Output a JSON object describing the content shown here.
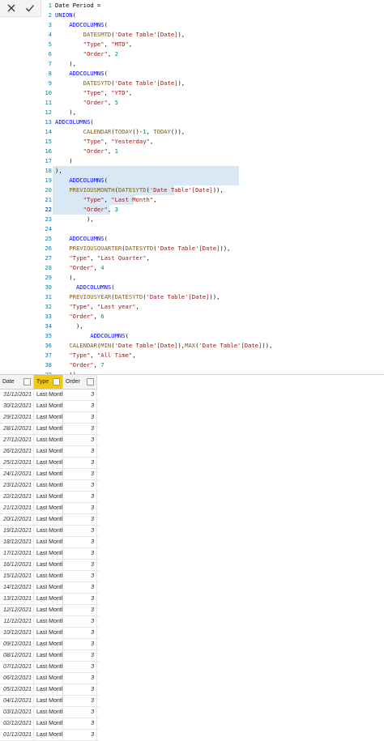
{
  "toolbar": {
    "cancel_icon": "close-icon",
    "commit_icon": "check-icon"
  },
  "editor": {
    "active_line": 22,
    "lines": [
      [
        [
          "p",
          "Date Period ="
        ]
      ],
      [
        [
          "k",
          "UNION"
        ],
        [
          "p",
          "("
        ]
      ],
      [
        [
          "p",
          "    "
        ],
        [
          "k",
          "ADDCOLUMNS"
        ],
        [
          "p",
          "("
        ]
      ],
      [
        [
          "p",
          "        "
        ],
        [
          "f",
          "DATESMTD"
        ],
        [
          "p",
          "("
        ],
        [
          "s",
          "'Date Table'[Date]"
        ],
        [
          "p",
          "),"
        ]
      ],
      [
        [
          "p",
          "        "
        ],
        [
          "s",
          "\"Type\""
        ],
        [
          "p",
          ", "
        ],
        [
          "s",
          "\"MTD\""
        ],
        [
          "p",
          ","
        ]
      ],
      [
        [
          "p",
          "        "
        ],
        [
          "s",
          "\"Order\""
        ],
        [
          "p",
          ", "
        ],
        [
          "n",
          "2"
        ]
      ],
      [
        [
          "p",
          "    ),"
        ]
      ],
      [
        [
          "p",
          "    "
        ],
        [
          "k",
          "ADDCOLUMNS"
        ],
        [
          "p",
          "("
        ]
      ],
      [
        [
          "p",
          "        "
        ],
        [
          "f",
          "DATESYTD"
        ],
        [
          "p",
          "("
        ],
        [
          "s",
          "'Date Table'[Date]"
        ],
        [
          "p",
          "),"
        ]
      ],
      [
        [
          "p",
          "        "
        ],
        [
          "s",
          "\"Type\""
        ],
        [
          "p",
          ", "
        ],
        [
          "s",
          "\"YTD\""
        ],
        [
          "p",
          ","
        ]
      ],
      [
        [
          "p",
          "        "
        ],
        [
          "s",
          "\"Order\""
        ],
        [
          "p",
          ", "
        ],
        [
          "n",
          "5"
        ]
      ],
      [
        [
          "p",
          "    ),"
        ]
      ],
      [
        [
          "k",
          "ADDCOLUMNS"
        ],
        [
          "p",
          "("
        ]
      ],
      [
        [
          "p",
          "        "
        ],
        [
          "f",
          "CALENDAR"
        ],
        [
          "p",
          "("
        ],
        [
          "f",
          "TODAY"
        ],
        [
          "p",
          "()-"
        ],
        [
          "n",
          "1"
        ],
        [
          "p",
          ", "
        ],
        [
          "f",
          "TODAY"
        ],
        [
          "p",
          "()),"
        ]
      ],
      [
        [
          "p",
          "        "
        ],
        [
          "s",
          "\"Type\""
        ],
        [
          "p",
          ", "
        ],
        [
          "s",
          "\"Yesterday\""
        ],
        [
          "p",
          ","
        ]
      ],
      [
        [
          "p",
          "        "
        ],
        [
          "s",
          "\"Order\""
        ],
        [
          "p",
          ", "
        ],
        [
          "n",
          "1"
        ]
      ],
      [
        [
          "p",
          "    )"
        ]
      ],
      [
        [
          "p",
          "),"
        ]
      ],
      [
        [
          "p",
          "    "
        ],
        [
          "k",
          "ADDCOLUMNS"
        ],
        [
          "p",
          "("
        ]
      ],
      [
        [
          "p",
          "    "
        ],
        [
          "f",
          "PREVIOUSMONTH"
        ],
        [
          "p",
          "("
        ],
        [
          "f",
          "DATESYTD"
        ],
        [
          "p",
          "("
        ],
        [
          "s",
          "'Date Table'[Date]"
        ],
        [
          "p",
          ")),"
        ]
      ],
      [
        [
          "p",
          "        "
        ],
        [
          "s",
          "\"Type\""
        ],
        [
          "p",
          ", "
        ],
        [
          "s",
          "\"Last Month\""
        ],
        [
          "p",
          ","
        ]
      ],
      [
        [
          "p",
          "        "
        ],
        [
          "s",
          "\"Order\""
        ],
        [
          "p",
          ", "
        ],
        [
          "n",
          "3"
        ]
      ],
      [
        [
          "p",
          "         ),"
        ]
      ],
      [
        [
          "p",
          ""
        ]
      ],
      [
        [
          "p",
          "    "
        ],
        [
          "k",
          "ADDCOLUMNS"
        ],
        [
          "p",
          "("
        ]
      ],
      [
        [
          "p",
          "    "
        ],
        [
          "f",
          "PREVIOUSQUARTER"
        ],
        [
          "p",
          "("
        ],
        [
          "f",
          "DATESYTD"
        ],
        [
          "p",
          "("
        ],
        [
          "s",
          "'Date Table'[Date]"
        ],
        [
          "p",
          ")),"
        ]
      ],
      [
        [
          "p",
          "    "
        ],
        [
          "s",
          "\"Type\""
        ],
        [
          "p",
          ", "
        ],
        [
          "s",
          "\"Last Quarter\""
        ],
        [
          "p",
          ","
        ]
      ],
      [
        [
          "p",
          "    "
        ],
        [
          "s",
          "\"Order\""
        ],
        [
          "p",
          ", "
        ],
        [
          "n",
          "4"
        ]
      ],
      [
        [
          "p",
          "    ),"
        ]
      ],
      [
        [
          "p",
          "      "
        ],
        [
          "k",
          "ADDCOLUMNS"
        ],
        [
          "p",
          "("
        ]
      ],
      [
        [
          "p",
          "    "
        ],
        [
          "f",
          "PREVIOUSYEAR"
        ],
        [
          "p",
          "("
        ],
        [
          "f",
          "DATESYTD"
        ],
        [
          "p",
          "("
        ],
        [
          "s",
          "'Date Table'[Date]"
        ],
        [
          "p",
          ")),"
        ]
      ],
      [
        [
          "p",
          "    "
        ],
        [
          "s",
          "\"Type\""
        ],
        [
          "p",
          ", "
        ],
        [
          "s",
          "\"Last year\""
        ],
        [
          "p",
          ","
        ]
      ],
      [
        [
          "p",
          "    "
        ],
        [
          "s",
          "\"Order\""
        ],
        [
          "p",
          ", "
        ],
        [
          "n",
          "6"
        ]
      ],
      [
        [
          "p",
          "      ),"
        ]
      ],
      [
        [
          "p",
          "          "
        ],
        [
          "k",
          "ADDCOLUMNS"
        ],
        [
          "p",
          "("
        ]
      ],
      [
        [
          "p",
          "    "
        ],
        [
          "f",
          "CALENDAR"
        ],
        [
          "p",
          "("
        ],
        [
          "f",
          "MIN"
        ],
        [
          "p",
          "("
        ],
        [
          "s",
          "'Date Table'[Date]"
        ],
        [
          "p",
          "),"
        ],
        [
          "f",
          "MAX"
        ],
        [
          "p",
          "("
        ],
        [
          "s",
          "'Date Table'[Date]"
        ],
        [
          "p",
          ")),"
        ]
      ],
      [
        [
          "p",
          "    "
        ],
        [
          "s",
          "\"Type\""
        ],
        [
          "p",
          ", "
        ],
        [
          "s",
          "\"All Time\""
        ],
        [
          "p",
          ","
        ]
      ],
      [
        [
          "p",
          "    "
        ],
        [
          "s",
          "\"Order\""
        ],
        [
          "p",
          ", "
        ],
        [
          "n",
          "7"
        ]
      ],
      [
        [
          "p",
          "    ))"
        ]
      ]
    ]
  },
  "table": {
    "headers": {
      "date": "Date",
      "type": "Type",
      "order": "Order"
    },
    "rows": [
      [
        "31/12/2021",
        "Last Month",
        "3"
      ],
      [
        "30/12/2021",
        "Last Month",
        "3"
      ],
      [
        "29/12/2021",
        "Last Month",
        "3"
      ],
      [
        "28/12/2021",
        "Last Month",
        "3"
      ],
      [
        "27/12/2021",
        "Last Month",
        "3"
      ],
      [
        "26/12/2021",
        "Last Month",
        "3"
      ],
      [
        "25/12/2021",
        "Last Month",
        "3"
      ],
      [
        "24/12/2021",
        "Last Month",
        "3"
      ],
      [
        "23/12/2021",
        "Last Month",
        "3"
      ],
      [
        "22/12/2021",
        "Last Month",
        "3"
      ],
      [
        "21/12/2021",
        "Last Month",
        "3"
      ],
      [
        "20/12/2021",
        "Last Month",
        "3"
      ],
      [
        "19/12/2021",
        "Last Month",
        "3"
      ],
      [
        "18/12/2021",
        "Last Month",
        "3"
      ],
      [
        "17/12/2021",
        "Last Month",
        "3"
      ],
      [
        "16/12/2021",
        "Last Month",
        "3"
      ],
      [
        "15/12/2021",
        "Last Month",
        "3"
      ],
      [
        "14/12/2021",
        "Last Month",
        "3"
      ],
      [
        "13/12/2021",
        "Last Month",
        "3"
      ],
      [
        "12/12/2021",
        "Last Month",
        "3"
      ],
      [
        "11/12/2021",
        "Last Month",
        "3"
      ],
      [
        "10/12/2021",
        "Last Month",
        "3"
      ],
      [
        "09/12/2021",
        "Last Month",
        "3"
      ],
      [
        "08/12/2021",
        "Last Month",
        "3"
      ],
      [
        "07/12/2021",
        "Last Month",
        "3"
      ],
      [
        "06/12/2021",
        "Last Month",
        "3"
      ],
      [
        "05/12/2021",
        "Last Month",
        "3"
      ],
      [
        "04/12/2021",
        "Last Month",
        "3"
      ],
      [
        "03/12/2021",
        "Last Month",
        "3"
      ],
      [
        "02/12/2021",
        "Last Month",
        "3"
      ],
      [
        "01/12/2021",
        "Last Month",
        "3"
      ]
    ]
  },
  "colors": {
    "keyword": "#0000ff",
    "function": "#795e26",
    "string": "#a31515",
    "number": "#098658",
    "line_number": "#237893",
    "filter_active": "#f2c811"
  }
}
